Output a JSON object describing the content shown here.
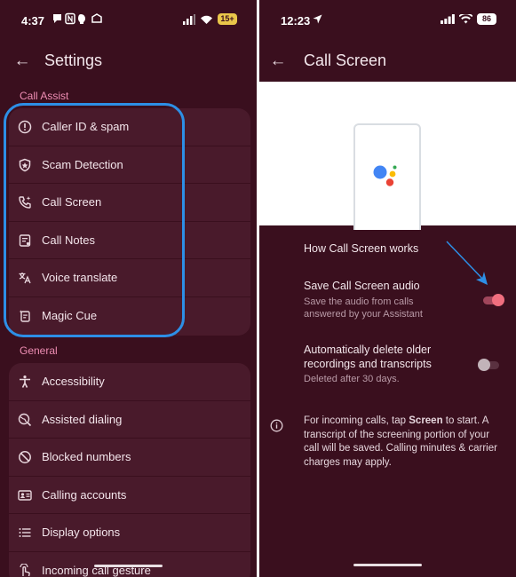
{
  "left": {
    "status": {
      "time": "4:37",
      "battery": "15+"
    },
    "title": "Settings",
    "sections": [
      {
        "label": "Call Assist",
        "items": [
          {
            "label": "Caller ID & spam",
            "icon": "info-circle-icon"
          },
          {
            "label": "Scam Detection",
            "icon": "shield-icon"
          },
          {
            "label": "Call Screen",
            "icon": "phone-sparkle-icon"
          },
          {
            "label": "Call Notes",
            "icon": "notes-icon"
          },
          {
            "label": "Voice translate",
            "icon": "translate-icon"
          },
          {
            "label": "Magic Cue",
            "icon": "magic-cue-icon"
          }
        ]
      },
      {
        "label": "General",
        "items": [
          {
            "label": "Accessibility",
            "icon": "accessibility-icon"
          },
          {
            "label": "Assisted dialing",
            "icon": "globe-icon"
          },
          {
            "label": "Blocked numbers",
            "icon": "block-icon"
          },
          {
            "label": "Calling accounts",
            "icon": "account-card-icon"
          },
          {
            "label": "Display options",
            "icon": "list-icon"
          },
          {
            "label": "Incoming call gesture",
            "icon": "gesture-icon"
          }
        ]
      }
    ]
  },
  "right": {
    "status": {
      "time": "12:23",
      "battery": "86"
    },
    "title": "Call Screen",
    "how_label": "How Call Screen works",
    "save_audio": {
      "title": "Save Call Screen audio",
      "subtitle_line1": "Save the audio from calls",
      "subtitle_line2": "answered by your Assistant",
      "enabled": true
    },
    "auto_delete": {
      "title_line1": "Automatically delete older",
      "title_line2": "recordings and transcripts",
      "subtitle": "Deleted after 30 days.",
      "enabled": false
    },
    "info": {
      "pre": "For incoming calls, tap ",
      "bold": "Screen",
      "post": " to start. A",
      "line2": "transcript of the screening portion of your",
      "line3": "call will be saved. Calling minutes & carrier",
      "line4": "charges may apply."
    }
  },
  "colors": {
    "background": "#3a0f1e",
    "card": "#491a2b",
    "section_label": "#ee8db3",
    "highlight": "#2d8fe6",
    "toggle_on": "#f06f7f"
  }
}
